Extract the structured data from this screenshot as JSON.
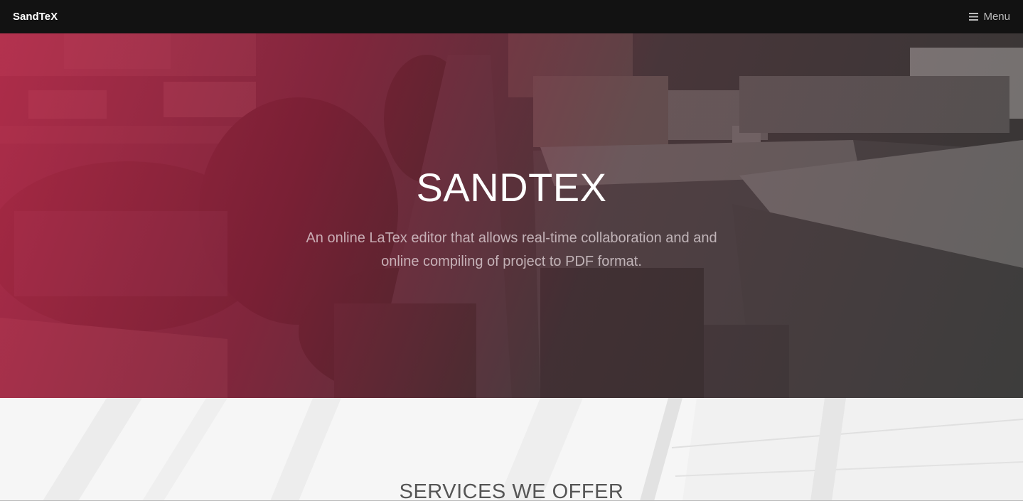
{
  "navbar": {
    "brand": "SandTeX",
    "menu_label": "Menu",
    "menu_icon": "hamburger-icon"
  },
  "hero": {
    "title": "SANDTEX",
    "subtitle": "An online LaTex editor that allows real-time collaboration and and online compiling of project to PDF format."
  },
  "services": {
    "heading": "SERVICES WE OFFER"
  },
  "colors": {
    "navbar_bg": "#121212",
    "accent_crimson": "#c4264a",
    "services_bg": "#f6f6f6",
    "heading_text": "#555555"
  }
}
